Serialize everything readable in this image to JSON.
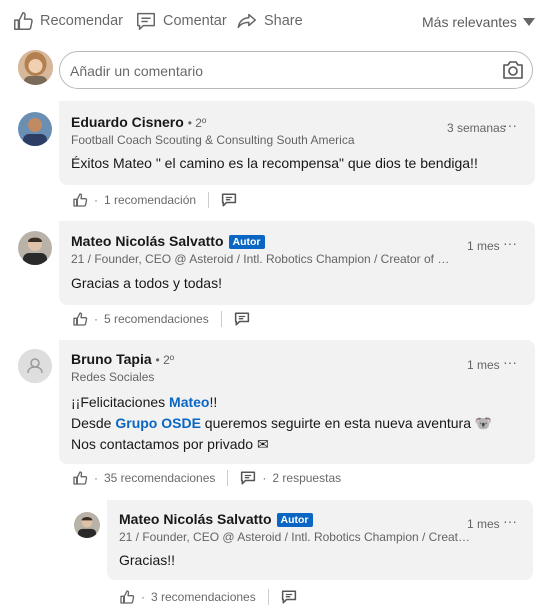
{
  "action_bar": {
    "like_label": "Recomendar",
    "comment_label": "Comentar",
    "share_label": "Share",
    "sort_label": "Más relevantes"
  },
  "composer": {
    "placeholder": "Añadir un comentario"
  },
  "comments": [
    {
      "author": "Eduardo Cisnero",
      "degree": "• 2º",
      "headline": "Football Coach Scouting & Consulting South America",
      "time": "3 semanas",
      "text": "Éxitos Mateo \" el camino es la recompensa\" que dios te bendiga!!",
      "reactions": "1 recomendación",
      "colors": {
        "avatar": "#3b5a78"
      }
    },
    {
      "author": "Mateo Nicolás Salvatto",
      "badge": "Autor",
      "headline": "21 / Founder, CEO @ Asteroid / Intl. Robotics Champion / Creator of app ...",
      "time": "1 mes",
      "text": "Gracias a todos y todas!",
      "reactions": "5 recomendaciones"
    },
    {
      "author": "Bruno Tapia",
      "degree": "• 2º",
      "headline": "Redes Sociales",
      "time": "1 mes",
      "line1_prefix": "¡¡Felicitaciones ",
      "line1_link": "Mateo",
      "line1_suffix": "!!",
      "line2_prefix": "Desde ",
      "line2_link": "Grupo OSDE",
      "line2_suffix": " queremos seguirte en esta nueva aventura 🐨",
      "line3": "Nos contactamos por privado ✉",
      "reactions": "35 recomendaciones",
      "replies": "2 respuestas"
    },
    {
      "author": "Mateo Nicolás Salvatto",
      "badge": "Autor",
      "headline": "21 / Founder, CEO @ Asteroid / Intl. Robotics Champion / Creato...",
      "time": "1 mes",
      "text": "Gracias!!",
      "reactions": "3 recomendaciones"
    }
  ],
  "footer_dot": "·",
  "more_glyph": "···",
  "colors": {
    "link": "#0a66c2",
    "bubble": "#f2f2f2",
    "badge": "#0a66c2"
  }
}
